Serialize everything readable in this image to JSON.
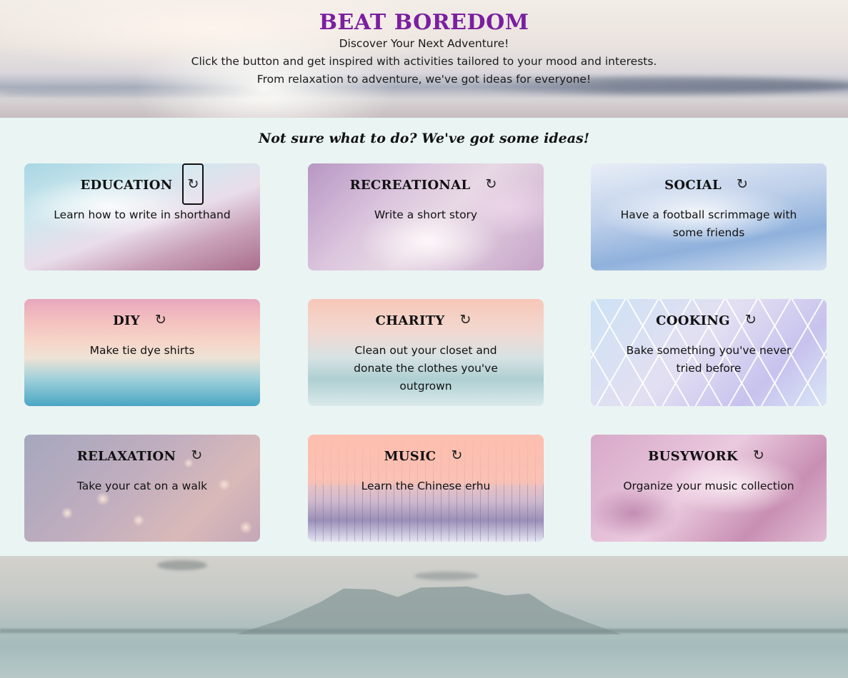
{
  "header": {
    "title": "BEAT BOREDOM",
    "subtitle": "Discover Your Next Adventure!",
    "line2": "Click the button and get inspired with activities tailored to your mood and interests.",
    "line3": "From relaxation to adventure, we've got ideas for everyone!"
  },
  "main": {
    "heading": "Not sure what to do? We've got some ideas!",
    "refresh_icon": "↻",
    "cards": [
      {
        "category": "EDUCATION",
        "activity": "Learn how to write in shorthand"
      },
      {
        "category": "RECREATIONAL",
        "activity": "Write a short story"
      },
      {
        "category": "SOCIAL",
        "activity": "Have a football scrimmage with some friends"
      },
      {
        "category": "DIY",
        "activity": "Make tie dye shirts"
      },
      {
        "category": "CHARITY",
        "activity": "Clean out your closet and donate the clothes you've outgrown"
      },
      {
        "category": "COOKING",
        "activity": "Bake something you've never tried before"
      },
      {
        "category": "RELAXATION",
        "activity": "Take your cat on a walk"
      },
      {
        "category": "MUSIC",
        "activity": "Learn the Chinese erhu"
      },
      {
        "category": "BUSYWORK",
        "activity": "Organize your music collection"
      }
    ]
  },
  "icons": {
    "refresh": "refresh-icon"
  },
  "colors": {
    "title": "#7a1fa0",
    "page_background": "#eaf4f3"
  }
}
